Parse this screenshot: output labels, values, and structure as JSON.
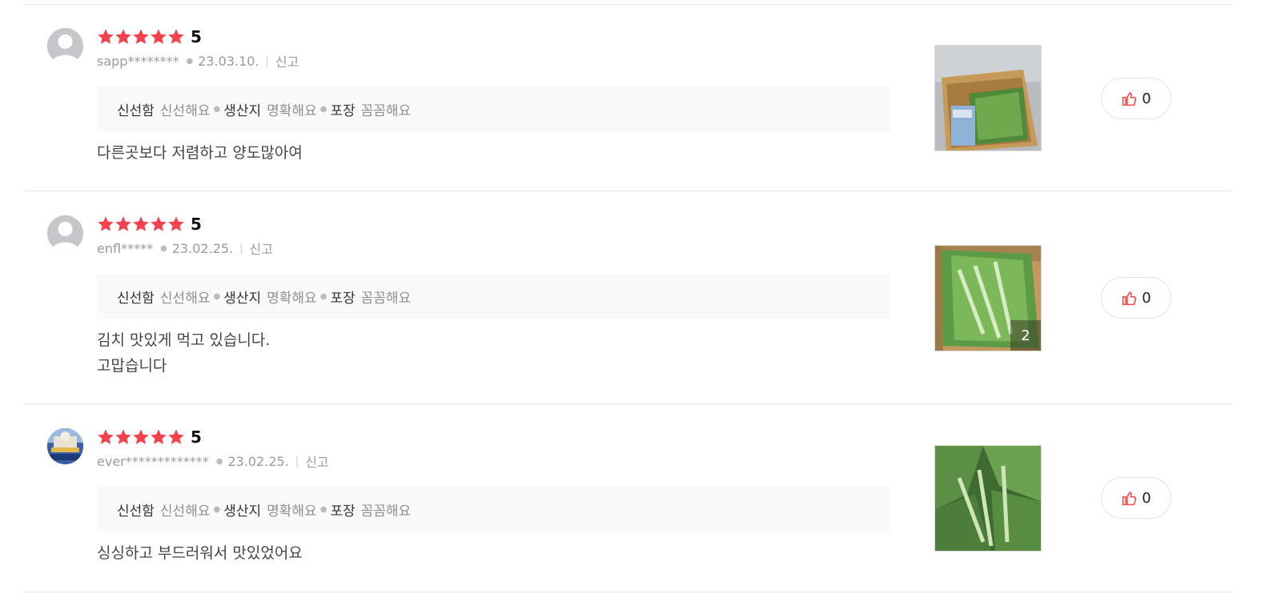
{
  "reviews": [
    {
      "score": "5",
      "user": "sapp********",
      "date": "23.03.10.",
      "report_label": "신고",
      "tags": [
        {
          "key": "신선함",
          "value": "신선해요"
        },
        {
          "key": "생산지",
          "value": "명확해요"
        },
        {
          "key": "포장",
          "value": "꼼꼼해요"
        }
      ],
      "content_lines": [
        "다른곳보다 저렴하고 양도많아여"
      ],
      "photo_count": "",
      "likes": "0"
    },
    {
      "score": "5",
      "user": "enfl*****",
      "date": "23.02.25.",
      "report_label": "신고",
      "tags": [
        {
          "key": "신선함",
          "value": "신선해요"
        },
        {
          "key": "생산지",
          "value": "명확해요"
        },
        {
          "key": "포장",
          "value": "꼼꼼해요"
        }
      ],
      "content_lines": [
        "김치 맛있게 먹고 있습니다.",
        "고맙습니다"
      ],
      "photo_count": "2",
      "likes": "0"
    },
    {
      "score": "5",
      "user": "ever*************",
      "date": "23.02.25.",
      "report_label": "신고",
      "tags": [
        {
          "key": "신선함",
          "value": "신선해요"
        },
        {
          "key": "생산지",
          "value": "명확해요"
        },
        {
          "key": "포장",
          "value": "꼼꼼해요"
        }
      ],
      "content_lines": [
        "싱싱하고 부드러워서 맛있었어요"
      ],
      "photo_count": "",
      "likes": "0"
    }
  ],
  "colors": {
    "star": "#f4424c",
    "like_icon": "#f04a4a",
    "tag_bg": "#f8f9fa"
  },
  "icons": {
    "star": "star-icon",
    "like": "thumbs-up-icon",
    "avatar_default": "user-silhouette-icon"
  }
}
